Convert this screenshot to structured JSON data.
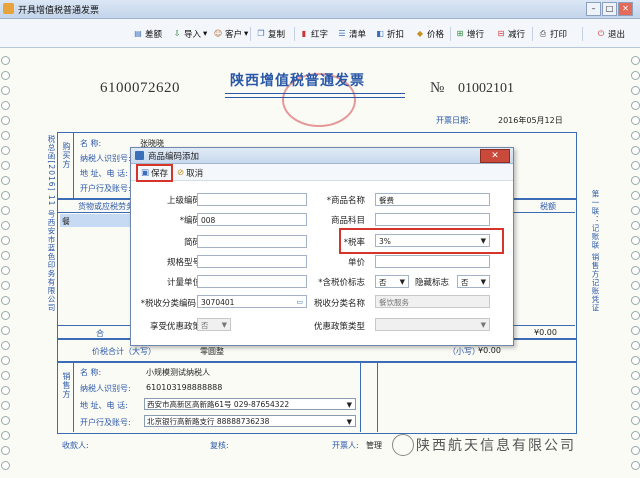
{
  "window": {
    "title": "开具增值税普通发票"
  },
  "toolbar": {
    "items": [
      {
        "label": "差额",
        "icon": "doc-icon"
      },
      {
        "label": "导入",
        "icon": "import-icon"
      },
      {
        "label": "客户",
        "icon": "customer-icon"
      },
      {
        "label": "复制",
        "icon": "copy-icon"
      },
      {
        "label": "红字",
        "icon": "red-icon"
      },
      {
        "label": "清单",
        "icon": "list-icon"
      },
      {
        "label": "折扣",
        "icon": "discount-icon"
      },
      {
        "label": "价格",
        "icon": "price-icon"
      },
      {
        "label": "增行",
        "icon": "add-row-icon"
      },
      {
        "label": "减行",
        "icon": "remove-row-icon"
      },
      {
        "label": "打印",
        "icon": "print-icon"
      },
      {
        "label": "退出",
        "icon": "power-icon"
      }
    ],
    "dropdown_marker": "▾"
  },
  "invoice": {
    "code": "6100072620",
    "title": "陕西增值税普通发票",
    "number_symbol": "№",
    "number": "01002101",
    "date_label": "开票日期:",
    "date_value": "2016年05月12日",
    "buyer": {
      "section_label": "购买方",
      "name_label": "名    称:",
      "name_value": "张晓晓",
      "tax_id_label": "纳税人识别号:",
      "address_label": "地 址、电 话:",
      "bank_label": "开户行及账号:"
    },
    "goods_header": "货物或应税劳务、服务名称",
    "goods_row1": "餐",
    "tax_amount_header": "税额",
    "total_label": "合",
    "total_amount": "¥0.00",
    "total_words_label": "价税合计（大写）",
    "total_words_value": "零圆整",
    "total_small_label": "（小写）",
    "total_small_value": "¥0.00",
    "seller": {
      "section_label": "销售方",
      "name_label": "名    称:",
      "name_value": "小规模测试纳税人",
      "tax_id_label": "纳税人识别号:",
      "tax_id_value": "610103198888888",
      "address_label": "地 址、电 话:",
      "address_value": "西安市高新区高新路61号 029-87654322",
      "bank_label": "开户行及账号:",
      "bank_value": "北京银行高新路支行 88888736238"
    },
    "payee_label": "收款人:",
    "reviewer_label": "复核:",
    "issuer_label": "开票人:",
    "issuer_value": "管理",
    "side_left": "税总函[2016] 11 号西安市蓝色印务有限公司",
    "side_right": "第一联：记账联 销售方记账凭证"
  },
  "dialog": {
    "title": "商品编码添加",
    "save_label": "保存",
    "cancel_label": "取消",
    "close_label": "✕",
    "fields": {
      "parent_code_label": "上级编码",
      "code_label": "*编码",
      "code_value": "008",
      "short_code_label": "简码",
      "spec_label": "规格型号",
      "unit_label": "计量单位",
      "tax_class_label": "*税收分类编码",
      "tax_class_value": "3070401",
      "preferential_label": "享受优惠政策",
      "preferential_value": "否",
      "name_label": "*商品名称",
      "name_value": "餐费",
      "subject_label": "商品科目",
      "rate_label": "*税率",
      "rate_value": "3%",
      "price_label": "单价",
      "tax_incl_label": "*含税价标志",
      "tax_incl_value": "否",
      "hidden_label": "隐藏标志",
      "hidden_value": "否",
      "tax_class_name_label": "税收分类名称",
      "tax_class_name_value": "餐饮服务",
      "policy_type_label": "优惠政策类型"
    }
  },
  "watermark": "陕西航天信息有限公司"
}
